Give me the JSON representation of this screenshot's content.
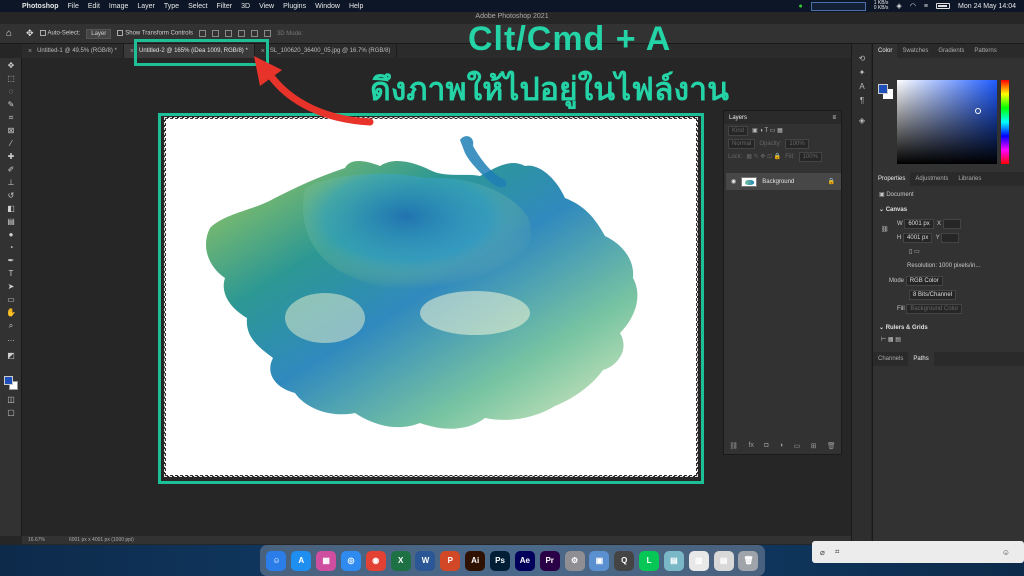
{
  "menubar": {
    "app_name": "Photoshop",
    "menus": [
      "File",
      "Edit",
      "Image",
      "Layer",
      "Type",
      "Select",
      "Filter",
      "3D",
      "View",
      "Plugins",
      "Window",
      "Help"
    ],
    "clock": "Mon 24 May  14:04",
    "net_up": "1 KB/s",
    "net_down": "0 KB/s"
  },
  "window_title": "Adobe Photoshop 2021",
  "options_bar": {
    "auto_select_label": "Auto-Select:",
    "auto_select_target": "Layer",
    "transform_controls_label": "Show Transform Controls",
    "mode_3d_label": "3D Mode:"
  },
  "doc_tabs": [
    {
      "label": "Untitled-1 @ 49.5% (RGB/8) *"
    },
    {
      "label": "Untitled-2 @ 165% (iDea 1009, RGB/8) *"
    },
    {
      "label": "SL_100620_36400_05.jpg @ 16.7% (RGB/8)"
    }
  ],
  "overlay": {
    "shortcut": "Clt/Cmd + A",
    "thai": "ดึงภาพให้ไปอยู่ในไฟล์งาน",
    "accent": "#24d3a6",
    "arrow_color": "#e8332a"
  },
  "status": {
    "zoom": "16.67%",
    "doc_size": "6001 px x 4001 px (1000 ppi)"
  },
  "color_panel": {
    "tabs": [
      "Color",
      "Swatches",
      "Gradients",
      "Patterns"
    ],
    "foreground": "#1f4fb8",
    "background": "#ffffff"
  },
  "properties_panel": {
    "tabs": [
      "Properties",
      "Adjustments",
      "Libraries"
    ],
    "type_label": "Document",
    "canvas_heading": "Canvas",
    "w_label": "W",
    "w_value": "6001 px",
    "h_label": "H",
    "h_value": "4001 px",
    "x_label": "X",
    "y_label": "Y",
    "resolution": "Resolution: 1000 pixels/in...",
    "mode_label": "Mode",
    "mode_value": "RGB Color",
    "depth_value": "8 Bits/Channel",
    "fill_label": "Fill",
    "fill_value": "Background Color",
    "rulers_heading": "Rulers & Grids"
  },
  "channels_tabs": [
    "Channels",
    "Paths"
  ],
  "layers_panel": {
    "title": "Layers",
    "kind_placeholder": "Kind",
    "blend_mode": "Normal",
    "opacity_label": "Opacity:",
    "opacity_value": "100%",
    "lock_label": "Lock:",
    "fill_label": "Fill:",
    "fill_value": "100%",
    "layer_name": "Background"
  },
  "dock": {
    "apps": [
      {
        "name": "Finder",
        "color": "#2b7de9",
        "glyph": "☺"
      },
      {
        "name": "App Store",
        "color": "#1e8ef0",
        "glyph": "A"
      },
      {
        "name": "Launchpad",
        "color": "#d04ea0",
        "glyph": "▦"
      },
      {
        "name": "Safari",
        "color": "#2f8bf0",
        "glyph": "◎"
      },
      {
        "name": "Chrome",
        "color": "#e34133",
        "glyph": "◉"
      },
      {
        "name": "Excel",
        "color": "#1e7145",
        "glyph": "X"
      },
      {
        "name": "Word",
        "color": "#2b5797",
        "glyph": "W"
      },
      {
        "name": "PowerPoint",
        "color": "#d24726",
        "glyph": "P"
      },
      {
        "name": "Illustrator",
        "color": "#2e1100",
        "glyph": "Ai"
      },
      {
        "name": "Photoshop",
        "color": "#001e36",
        "glyph": "Ps"
      },
      {
        "name": "After Effects",
        "color": "#00005b",
        "glyph": "Ae"
      },
      {
        "name": "Premiere",
        "color": "#2a0046",
        "glyph": "Pr"
      },
      {
        "name": "System Preferences",
        "color": "#8e8e93",
        "glyph": "⚙"
      },
      {
        "name": "Preview",
        "color": "#5a8fd0",
        "glyph": "▣"
      },
      {
        "name": "QuickTime",
        "color": "#444",
        "glyph": "Q"
      },
      {
        "name": "LINE",
        "color": "#06c755",
        "glyph": "L"
      },
      {
        "name": "Image 1",
        "color": "#7ab8c8",
        "glyph": "▤"
      },
      {
        "name": "Image 2",
        "color": "#e8e8e8",
        "glyph": "▥"
      },
      {
        "name": "Image 3",
        "color": "#d8d8d8",
        "glyph": "▤"
      },
      {
        "name": "Trash",
        "color": "#9fa4ab",
        "glyph": "🗑"
      }
    ]
  }
}
